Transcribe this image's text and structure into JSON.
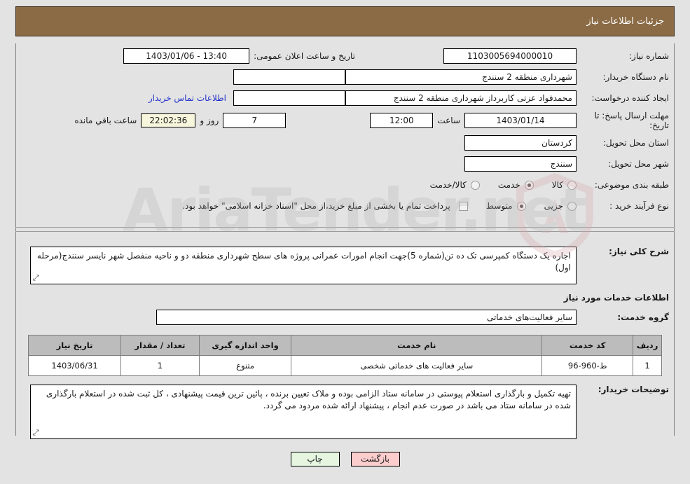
{
  "header": {
    "title": "جزئیات اطلاعات نیاز"
  },
  "form": {
    "need_number": {
      "label": "شماره نیاز:",
      "value": "1103005694000010"
    },
    "buyer_org": {
      "label": "نام دستگاه خریدار:",
      "value": "شهرداری منطقه 2 سنندج"
    },
    "creator": {
      "label": "ایجاد کننده درخواست:",
      "value": "محمدفواد عزتی کاربرداز شهرداری منطقه 2 سنندج"
    },
    "announce": {
      "label": "تاریخ و ساعت اعلان عمومی:",
      "value": "13:40 - 1403/01/06"
    },
    "empty_field": {
      "value": ""
    },
    "contact_link": {
      "label": "اطلاعات تماس خریدار"
    },
    "deadline": {
      "label": "مهلت ارسال پاسخ: تا تاریخ:",
      "date": "1403/01/14",
      "time_label": "ساعت",
      "time": "12:00",
      "days": "7",
      "days_label": "روز و",
      "countdown": "22:02:36",
      "countdown_label": "ساعت باقي مانده"
    },
    "province": {
      "label": "استان محل تحویل:",
      "value": "کردستان"
    },
    "city": {
      "label": "شهر محل تحویل:",
      "value": "سنندج"
    },
    "category": {
      "label": "طبقه بندی موضوعی:",
      "options": [
        "کالا",
        "خدمت",
        "کالا/خدمت"
      ],
      "selected_index": 1
    },
    "purchase_type": {
      "label": "نوع فرآیند خرید :",
      "options": [
        "جزیی",
        "متوسط"
      ],
      "selected_index": 1,
      "checkbox_label": "پرداخت تمام یا بخشی از مبلغ خرید،از محل \"اسناد خزانه اسلامی\" خواهد بود.",
      "checkbox_checked": false
    }
  },
  "description": {
    "label": "شرح کلی نیاز:",
    "value": "اجاره یک دستگاه کمپرسی تک ده تن(شماره 5)جهت انجام امورات عمرانی پروژه های سطح شهرداری منطقه دو و ناحیه منفصل شهر نایسر سنندج(مرحله اول)"
  },
  "services_section": {
    "heading": "اطلاعات خدمات مورد نیاز",
    "group": {
      "label": "گروه خدمت:",
      "value": "سایر فعالیت‌های خدماتی"
    },
    "table": {
      "headers": [
        "ردیف",
        "کد خدمت",
        "نام خدمت",
        "واحد اندازه گیری",
        "تعداد / مقدار",
        "تاریخ نیاز"
      ],
      "rows": [
        {
          "index": "1",
          "code": "ط-960-96",
          "name": "سایر فعالیت های خدماتی شخصی",
          "unit": "متنوع",
          "quantity": "1",
          "need_date": "1403/06/31"
        }
      ]
    }
  },
  "buyer_notes": {
    "label": "توضیحات خریدار:",
    "value": "تهیه  تکمیل و بارگذاری استعلام پیوستی در سامانه ستاد الزامی بوده و ملاک تعیین برنده ، پائین ترین قیمت پیشنهادی ، کل ثبت شده در استعلام بارگذاری شده در سامانه ستاد می باشد در صورت عدم انجام ، پیشنهاد ارائه شده مردود می گردد."
  },
  "buttons": {
    "back": "بازگشت",
    "print": "چاپ"
  },
  "watermark": {
    "text": "AriaTender.net"
  },
  "colors": {
    "header_bar": "#8b6b45",
    "page_bg": "#e3e3e3",
    "link": "#2233cc",
    "countdown_bg": "#f7f6dc",
    "back_btn": "#fbcdcd",
    "print_btn": "#e5f5e0",
    "table_header": "#bcbcbc"
  }
}
